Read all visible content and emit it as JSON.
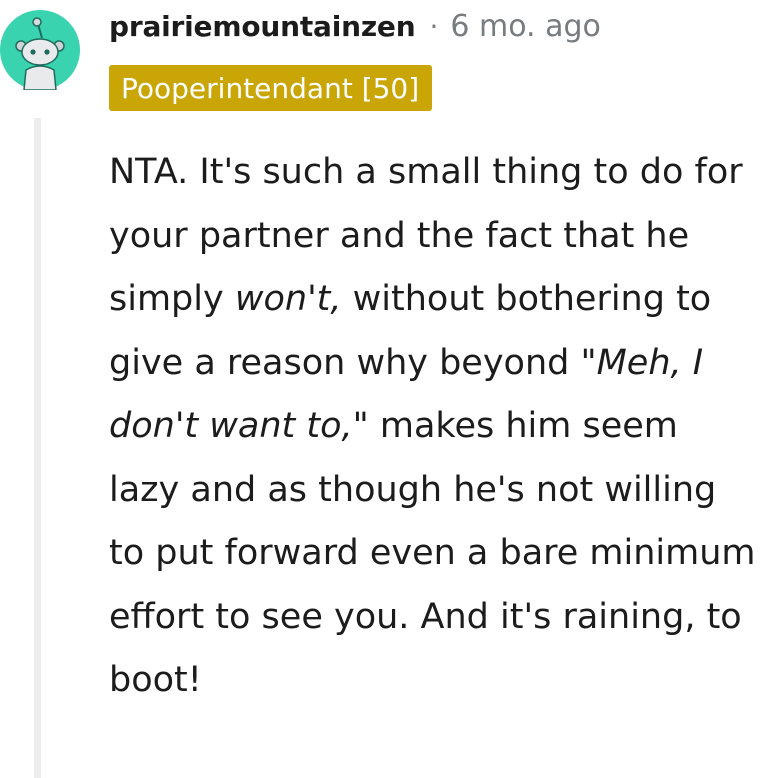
{
  "comment": {
    "avatar_icon": "snoo-avatar-icon",
    "avatar_color": "#3ad3b0",
    "username": "prairiemountainzen",
    "separator": "·",
    "time": "6 mo. ago",
    "flair": "Pooperintendant [50]",
    "flair_color": "#c9a506",
    "body": {
      "t1": "NTA. It's such a small thing to do for your partner and the fact that he simply ",
      "em1": "won't,",
      "t2": " without bothering to give a reason why beyond ",
      "em2": "\"Meh, I don't want to,\"",
      "t3": " makes him seem lazy and as though he's not willing to put forward even a bare minimum effort to see you. And it's raining, to boot!"
    }
  }
}
